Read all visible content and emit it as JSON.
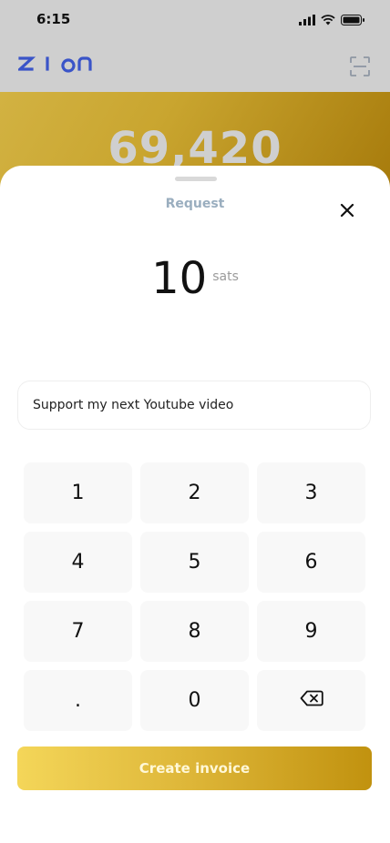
{
  "status": {
    "time": "6:15"
  },
  "app": {
    "logo_text": "zion",
    "accent": "#3a54c8"
  },
  "hero": {
    "balance": "69,420"
  },
  "sheet": {
    "title": "Request",
    "amount": "10",
    "unit": "sats",
    "memo_value": "Support my next Youtube video",
    "keys": [
      "1",
      "2",
      "3",
      "4",
      "5",
      "6",
      "7",
      "8",
      "9",
      ".",
      "0"
    ],
    "backspace_icon": "backspace-icon",
    "cta_label": "Create invoice"
  }
}
